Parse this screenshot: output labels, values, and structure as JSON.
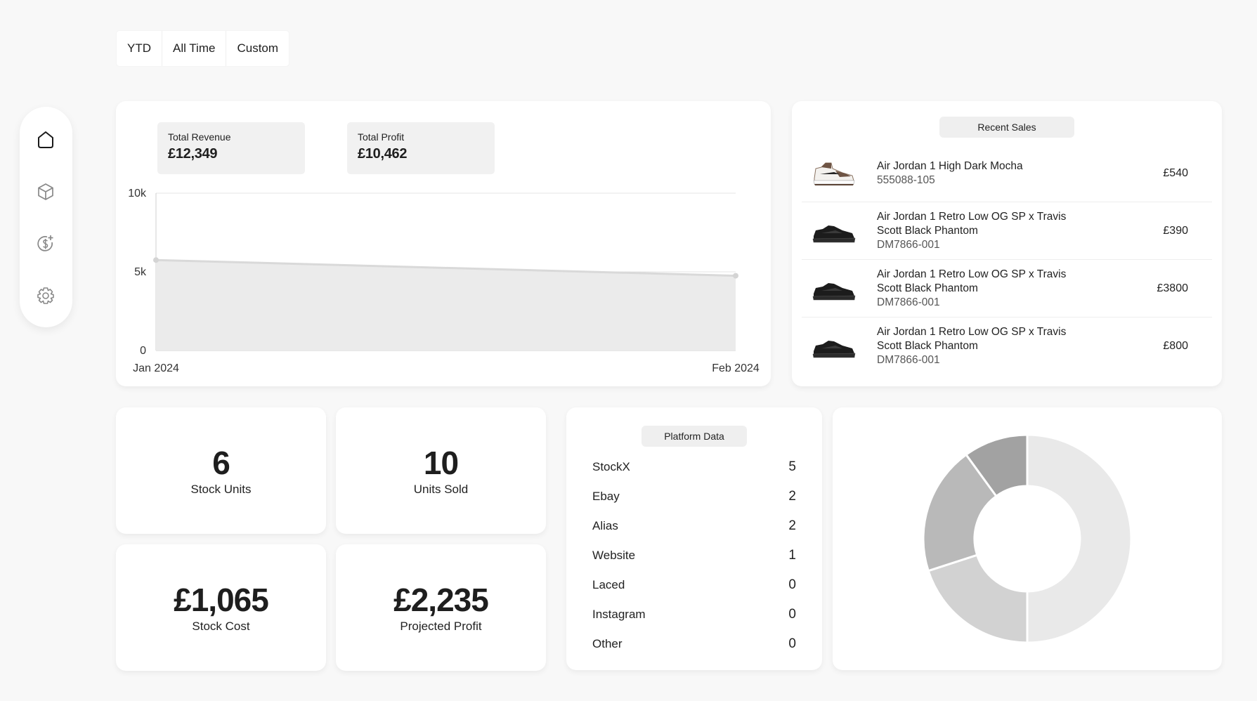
{
  "range_tabs": [
    "YTD",
    "All Time",
    "Custom"
  ],
  "sidebar": {
    "items": [
      {
        "icon": "home-icon"
      },
      {
        "icon": "package-icon"
      },
      {
        "icon": "dollar-plus-icon"
      },
      {
        "icon": "settings-gear-icon"
      }
    ]
  },
  "summary": {
    "revenue_label": "Total Revenue",
    "revenue_value": "£12,349",
    "profit_label": "Total Profit",
    "profit_value": "£10,462"
  },
  "chart_data": {
    "type": "area",
    "x": [
      "Jan 2024",
      "Feb 2024"
    ],
    "series": [
      {
        "values": [
          5750,
          4750
        ]
      }
    ],
    "yticks": [
      "0",
      "5k",
      "10k"
    ],
    "ylim": [
      0,
      10000
    ],
    "grid": true,
    "fill_color": "#ebebeb",
    "line_color": "#d9d9d9"
  },
  "recent_sales": {
    "title": "Recent Sales",
    "items": [
      {
        "name": "Air Jordan 1 High Dark Mocha",
        "sku": "555088-105",
        "price": "£540",
        "thumb": "sneaker-mocha"
      },
      {
        "name": "Air Jordan 1 Retro Low OG SP x Travis Scott Black Phantom",
        "sku": "DM7866-001",
        "price": "£390",
        "thumb": "sneaker-black"
      },
      {
        "name": "Air Jordan 1 Retro Low OG SP x Travis Scott Black Phantom",
        "sku": "DM7866-001",
        "price": "£3800",
        "thumb": "sneaker-black"
      },
      {
        "name": "Air Jordan 1 Retro Low OG SP x Travis Scott Black Phantom",
        "sku": "DM7866-001",
        "price": "£800",
        "thumb": "sneaker-black"
      }
    ]
  },
  "metrics": {
    "stock_units": {
      "value": "6",
      "label": "Stock Units"
    },
    "units_sold": {
      "value": "10",
      "label": "Units Sold"
    },
    "stock_cost": {
      "value": "£1,065",
      "label": "Stock Cost"
    },
    "projected_profit": {
      "value": "£2,235",
      "label": "Projected Profit"
    }
  },
  "platform_data": {
    "title": "Platform Data",
    "rows": [
      {
        "name": "StockX",
        "count": "5"
      },
      {
        "name": "Ebay",
        "count": "2"
      },
      {
        "name": "Alias",
        "count": "2"
      },
      {
        "name": "Website",
        "count": "1"
      },
      {
        "name": "Laced",
        "count": "0"
      },
      {
        "name": "Instagram",
        "count": "0"
      },
      {
        "name": "Other",
        "count": "0"
      }
    ]
  },
  "platform_chart": {
    "type": "pie",
    "labels": [
      "StockX",
      "Ebay",
      "Alias",
      "Website"
    ],
    "values": [
      5,
      2,
      2,
      1
    ],
    "colors": [
      "#e9e9e9",
      "#d2d2d2",
      "#b9b9b9",
      "#a2a2a2"
    ]
  }
}
